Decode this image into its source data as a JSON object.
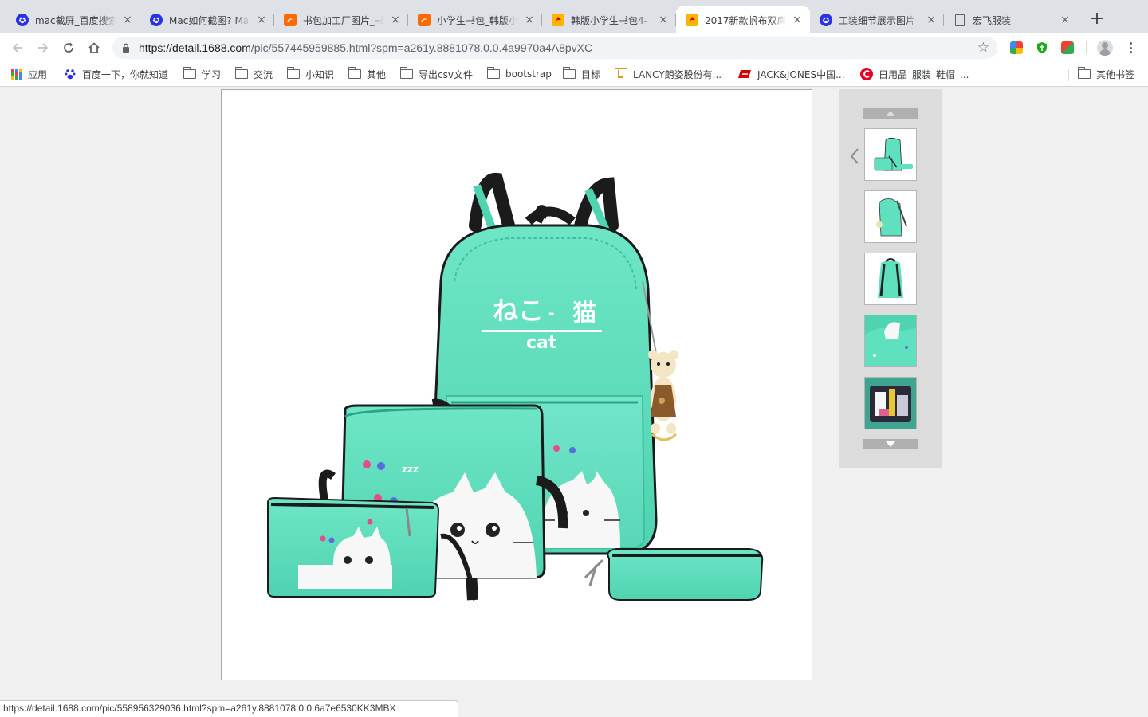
{
  "browser": {
    "tabs": [
      {
        "title": "mac截屏_百度搜索",
        "favicon": "baidu-icon",
        "active": false
      },
      {
        "title": "Mac如何截图? Ma",
        "favicon": "baidu-icon",
        "active": false
      },
      {
        "title": "书包加工厂图片_书",
        "favicon": "alibaba-icon",
        "active": false
      },
      {
        "title": "小学生书包_韩版小",
        "favicon": "alibaba-icon",
        "active": false
      },
      {
        "title": "韩版小学生书包4-",
        "favicon": "1688-icon",
        "active": false
      },
      {
        "title": "2017新款帆布双肩",
        "favicon": "1688-icon",
        "active": true
      },
      {
        "title": "工装细节展示图片",
        "favicon": "baidu-icon",
        "active": false
      },
      {
        "title": "宏飞服装",
        "favicon": "document-icon",
        "active": false
      }
    ],
    "new_tab_label": "+",
    "close_label": "×",
    "url_host": "https://detail.1688.com",
    "url_path": "/pic/557445959885.html?spm=a261y.8881078.0.0.4a9970a4A8pvXC",
    "bookmarks": [
      {
        "label": "应用",
        "icon": "apps-grid-icon"
      },
      {
        "label": "百度一下，你就知道",
        "icon": "baidu-icon"
      },
      {
        "label": "学习",
        "icon": "folder-icon"
      },
      {
        "label": "交流",
        "icon": "folder-icon"
      },
      {
        "label": "小知识",
        "icon": "folder-icon"
      },
      {
        "label": "其他",
        "icon": "folder-icon"
      },
      {
        "label": "导出csv文件",
        "icon": "folder-icon"
      },
      {
        "label": "bootstrap",
        "icon": "folder-icon"
      },
      {
        "label": "目标",
        "icon": "folder-icon"
      },
      {
        "label": "LANCY朗姿股份有...",
        "icon": "lancy-icon"
      },
      {
        "label": "JACK&JONES中国...",
        "icon": "jackjones-icon"
      },
      {
        "label": "日用品_服装_鞋帽_...",
        "icon": "c-logo-icon"
      }
    ],
    "other_bookmarks": "其他书签",
    "status_url": "https://detail.1688.com/pic/558956329036.html?spm=a261y.8881078.0.0.6a7e6530KK3MBX"
  },
  "product": {
    "bag_text_jp": "ねこ",
    "bag_text_dash": "-",
    "bag_text_cn": "猫",
    "bag_text_en": "cat",
    "bag_sleep_text": "zzz",
    "main_color": "#5fe0bf",
    "thumbnails": [
      {
        "id": "thumb-1"
      },
      {
        "id": "thumb-2"
      },
      {
        "id": "thumb-3"
      },
      {
        "id": "thumb-4"
      },
      {
        "id": "thumb-5"
      }
    ]
  },
  "colors": {
    "tabstrip": "#dee1e6",
    "accent_teal": "#5fe0bf",
    "panel": "#dcdcdc"
  }
}
